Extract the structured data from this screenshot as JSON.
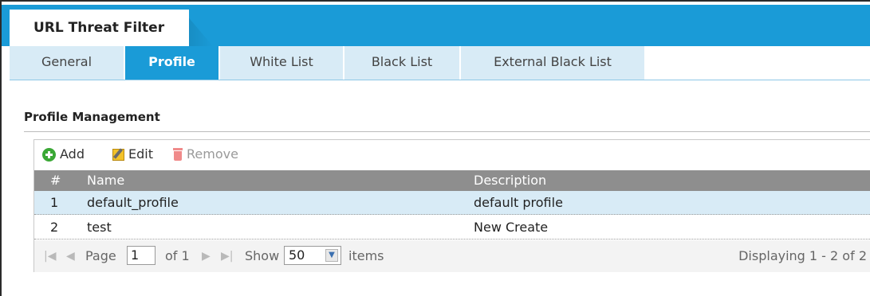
{
  "header": {
    "title": "URL Threat Filter"
  },
  "tabs": [
    {
      "label": "General",
      "active": false
    },
    {
      "label": "Profile",
      "active": true
    },
    {
      "label": "White List",
      "active": false
    },
    {
      "label": "Black List",
      "active": false
    },
    {
      "label": "External Black List",
      "active": false
    }
  ],
  "section": {
    "title": "Profile Management"
  },
  "toolbar": {
    "add": "Add",
    "edit": "Edit",
    "remove": "Remove"
  },
  "table": {
    "columns": [
      "#",
      "Name",
      "Description"
    ],
    "rows": [
      {
        "num": "1",
        "name": "default_profile",
        "description": "default profile",
        "selected": true
      },
      {
        "num": "2",
        "name": "test",
        "description": "New Create",
        "selected": false
      }
    ]
  },
  "pager": {
    "page_label": "Page",
    "page_value": "1",
    "of_label": "of 1",
    "show_label": "Show",
    "show_value": "50",
    "items_label": "items",
    "displaying": "Displaying 1 - 2 of 2"
  },
  "colors": {
    "accent": "#1a9bd7",
    "tab_inactive": "#d8ebf6",
    "header_gray": "#8e8e8e"
  }
}
